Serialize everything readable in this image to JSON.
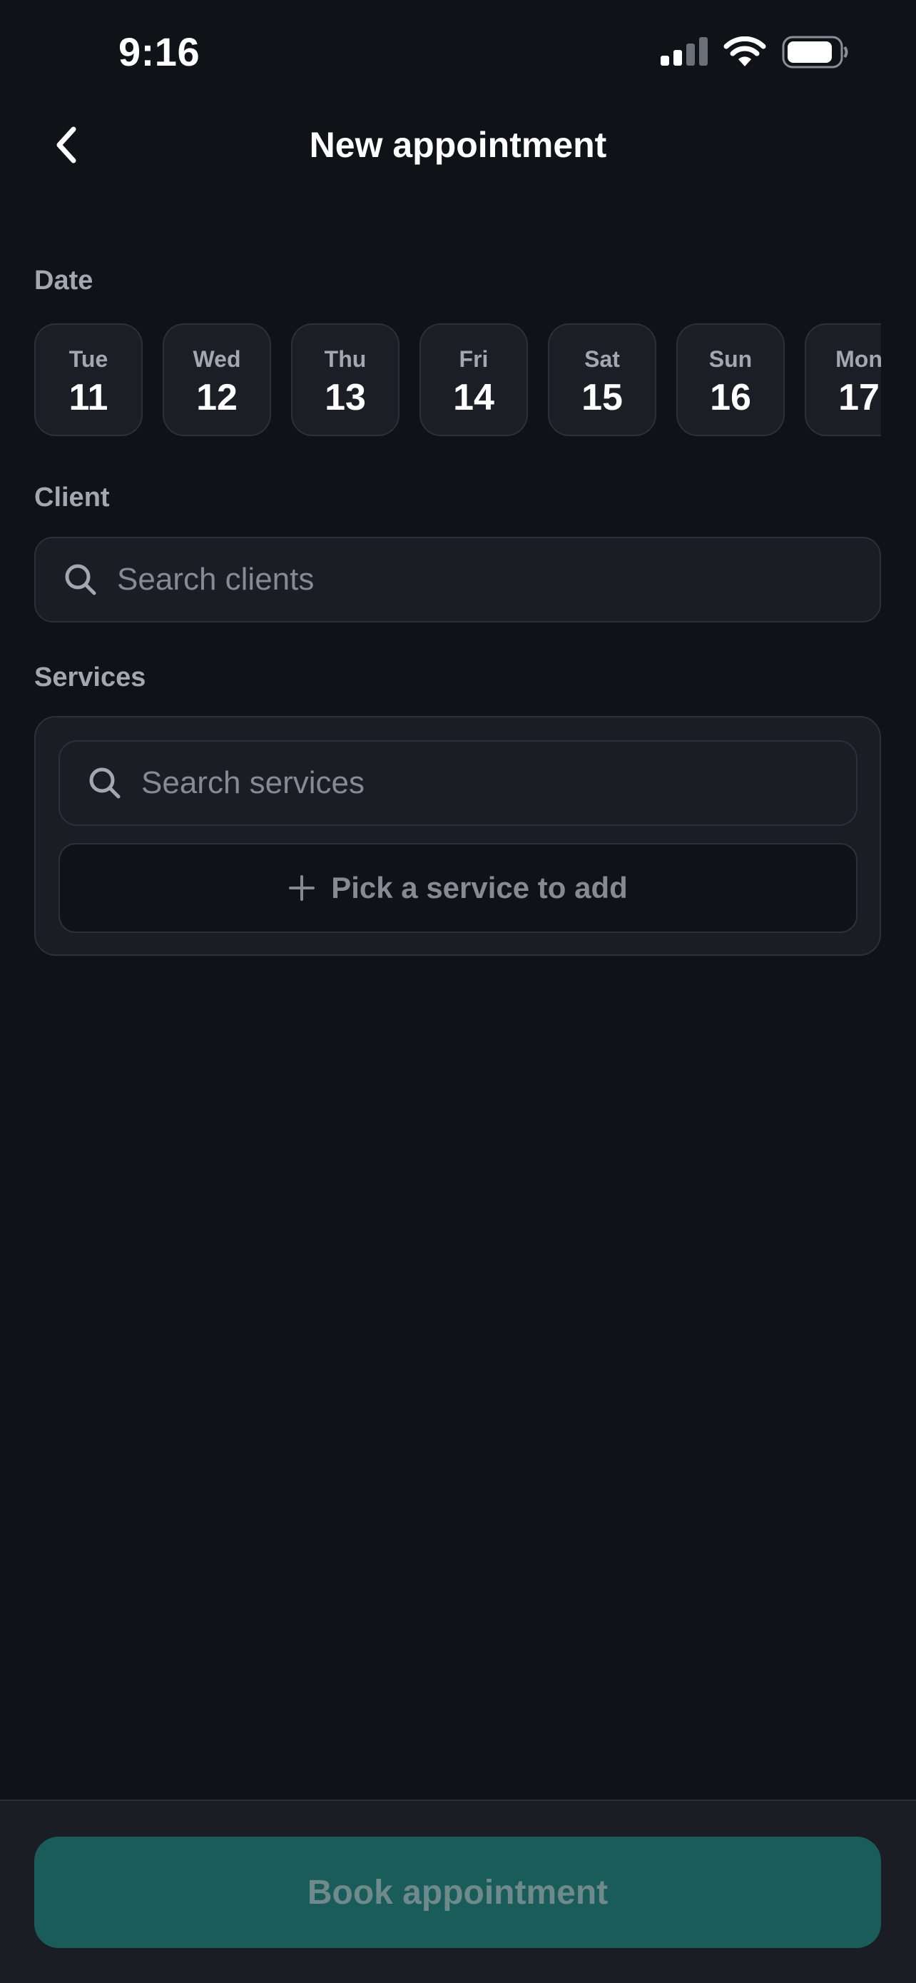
{
  "status_bar": {
    "time": "9:16",
    "icons": [
      "cellular-signal-icon",
      "wifi-icon",
      "battery-icon"
    ]
  },
  "nav": {
    "back_icon": "chevron-left-icon",
    "title": "New appointment"
  },
  "date_section": {
    "label": "Date",
    "days": [
      {
        "dow": "Tue",
        "num": "11"
      },
      {
        "dow": "Wed",
        "num": "12"
      },
      {
        "dow": "Thu",
        "num": "13"
      },
      {
        "dow": "Fri",
        "num": "14"
      },
      {
        "dow": "Sat",
        "num": "15"
      },
      {
        "dow": "Sun",
        "num": "16"
      },
      {
        "dow": "Mon",
        "num": "17"
      }
    ]
  },
  "client_section": {
    "label": "Client",
    "search_placeholder": "Search clients"
  },
  "services_section": {
    "label": "Services",
    "search_placeholder": "Search services",
    "pick_label": "Pick a service to add"
  },
  "footer": {
    "book_label": "Book appointment"
  },
  "colors": {
    "background": "#0f1216",
    "surface": "#1a1d23",
    "border": "#2c3038",
    "muted_text": "#a2a7b0",
    "placeholder_text": "#858a93",
    "accent_disabled": "#1a5c5a"
  }
}
